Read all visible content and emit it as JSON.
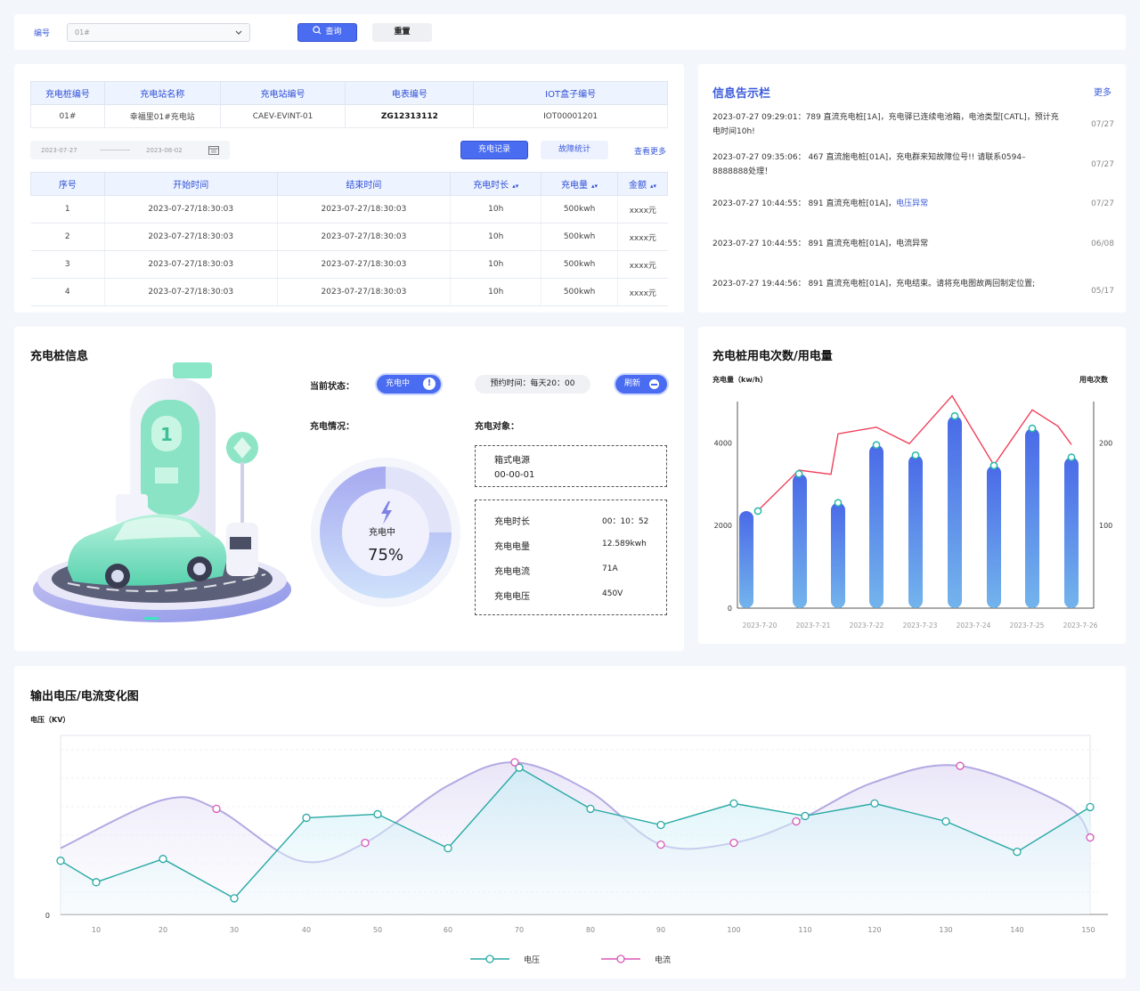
{
  "filter": {
    "label": "编号",
    "select_value": "01#",
    "query_button": "查询",
    "reset_button": "重置"
  },
  "pile_table": {
    "headers": [
      "充电桩编号",
      "充电站名称",
      "充电站编号",
      "电表编号",
      "IOT盒子编号"
    ],
    "row": [
      "01#",
      "幸福里01#充电站",
      "CAEV-EVINT-01",
      "ZG12313112",
      "IOT00001201"
    ]
  },
  "date_range": {
    "start": "2023-07-27",
    "end": "2023-08-02"
  },
  "record_tabs": {
    "records": "充电记录",
    "faults": "故障统计",
    "more": "查看更多"
  },
  "record_table": {
    "headers": [
      "序号",
      "开始时间",
      "结束时间",
      "充电时长",
      "充电量",
      "金额"
    ],
    "rows": [
      [
        "1",
        "2023-07-27/18:30:03",
        "2023-07-27/18:30:03",
        "10h",
        "500kwh",
        "xxxx元"
      ],
      [
        "2",
        "2023-07-27/18:30:03",
        "2023-07-27/18:30:03",
        "10h",
        "500kwh",
        "xxxx元"
      ],
      [
        "3",
        "2023-07-27/18:30:03",
        "2023-07-27/18:30:03",
        "10h",
        "500kwh",
        "xxxx元"
      ],
      [
        "4",
        "2023-07-27/18:30:03",
        "2023-07-27/18:30:03",
        "10h",
        "500kwh",
        "xxxx元"
      ]
    ]
  },
  "notices": {
    "title": "信息告示栏",
    "more": "更多",
    "items": [
      {
        "text": "2023-07-27  09:29:01：789 直流充电桩[1A]，充电驿已连续电池箱，电池类型[CATL]，预计充电时间10h!",
        "highlight": "",
        "date": "07/27"
      },
      {
        "text": "2023-07-27 09:35:06： 467 直流施电桩[01A]，充电群来知故障位号!! 请联系0594–8888888处理！",
        "highlight": "",
        "date": "07/27"
      },
      {
        "text": "2023-07-27 10:44:55： 891 直流充电桩[01A]，",
        "highlight": "电压异常",
        "date": "07/27"
      },
      {
        "text": "2023-07-27 10:44:55： 891 直流充电桩[01A]，电流异常",
        "highlight": "",
        "date": "06/08"
      },
      {
        "text": "2023-07-27 19:44:56： 891 直流充电桩[01A]，充电结束。请将充电图故两回制定位置;",
        "highlight": "",
        "date": "05/17"
      }
    ]
  },
  "pile_info": {
    "title": "充电桩信息",
    "status_label": "当前状态：",
    "status_value": "充电中",
    "reserve_text": "预约时间：每天20：00",
    "refresh": "刷新",
    "situation_label": "充电情况：",
    "target_label": "充电对象：",
    "gauge_label": "充电中",
    "gauge_value": "75%",
    "gauge_percent": 75,
    "target_name": "箱式电源",
    "target_code": "00-00-01",
    "stats": [
      {
        "k": "充电时长",
        "v": "00：10：52"
      },
      {
        "k": "充电电量",
        "v": "12.589kwh"
      },
      {
        "k": "充电电流",
        "v": "71A"
      },
      {
        "k": "充电电压",
        "v": "450V"
      }
    ]
  },
  "usage_chart": {
    "title": "充电桩用电次数/用电量",
    "y_left_label": "充电量（kw/h）",
    "y_right_label": "用电次数",
    "left_ticks": [
      "0",
      "2000",
      "4000"
    ],
    "right_ticks": [
      "100",
      "200"
    ]
  },
  "wave_chart": {
    "title": "输出电压/电流变化图",
    "y_label": "电压（KV）",
    "x_ticks": [
      "10",
      "20",
      "30",
      "40",
      "50",
      "60",
      "70",
      "80",
      "90",
      "100",
      "110",
      "120",
      "130",
      "140",
      "150"
    ],
    "y_tick": "0",
    "legend": [
      "电压",
      "电流"
    ]
  },
  "chart_data": [
    {
      "type": "bar",
      "title": "充电桩用电次数/用电量",
      "categories": [
        "2023-7-20",
        "2023-7-21",
        "2023-7-22",
        "2023-7-23",
        "2023-7-24",
        "2023-7-25",
        "2023-7-26"
      ],
      "bar_x": [
        0,
        1,
        1.5,
        2,
        3,
        3.5,
        4,
        5,
        5.5,
        6
      ],
      "series": [
        {
          "axis": "left",
          "values": [
            2350,
            3250,
            2550,
            3950,
            3700,
            4650,
            3450,
            4350,
            3650
          ]
        },
        {
          "axis": "right",
          "values": [
            118,
            167,
            162,
            211,
            219,
            199,
            257,
            173,
            240,
            220,
            198
          ]
        }
      ],
      "xlabel": "",
      "ylabel": "充电量（kw/h）",
      "ylim_left": [
        0,
        5000
      ],
      "ylim_right": [
        0,
        250
      ]
    },
    {
      "type": "line",
      "title": "输出电压/电流变化图",
      "x_range": [
        5,
        150
      ],
      "series": [
        {
          "name": "电压",
          "x": [
            5,
            10,
            20,
            30,
            40,
            50,
            60,
            70,
            80,
            90,
            100,
            110,
            120,
            130,
            140,
            150
          ],
          "values": [
            30,
            18,
            31,
            9,
            54,
            56,
            37,
            82,
            59,
            50,
            62,
            55,
            62,
            52,
            35,
            60
          ]
        },
        {
          "name": "电流",
          "x": [
            5,
            20,
            28,
            40,
            48,
            60,
            70,
            80,
            90,
            100,
            110,
            120,
            132,
            145,
            150
          ],
          "values": [
            37,
            64,
            59,
            30,
            40,
            72,
            85,
            69,
            39,
            40,
            52,
            74,
            83,
            61,
            43
          ]
        }
      ],
      "ylabel": "电压（KV）",
      "ylim": [
        0,
        100
      ]
    }
  ]
}
